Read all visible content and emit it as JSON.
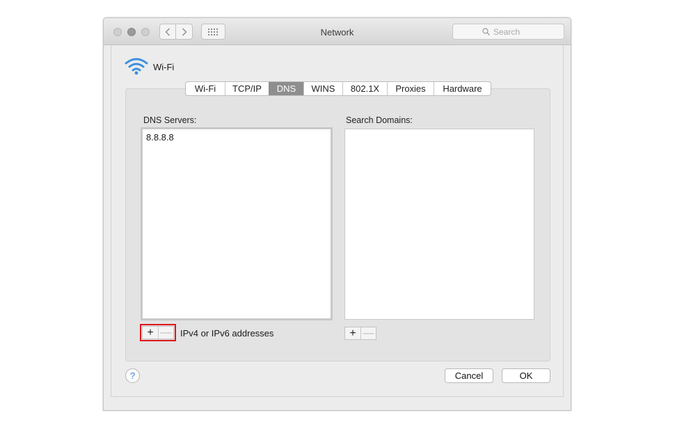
{
  "window": {
    "title": "Network",
    "search": {
      "placeholder": "Search"
    }
  },
  "interface": {
    "name": "Wi-Fi",
    "icon": "wifi-icon"
  },
  "tabs": [
    {
      "label": "Wi-Fi",
      "active": false
    },
    {
      "label": "TCP/IP",
      "active": false
    },
    {
      "label": "DNS",
      "active": true
    },
    {
      "label": "WINS",
      "active": false
    },
    {
      "label": "802.1X",
      "active": false
    },
    {
      "label": "Proxies",
      "active": false
    },
    {
      "label": "Hardware",
      "active": false
    }
  ],
  "dns": {
    "servers_label": "DNS Servers:",
    "servers": [
      "8.8.8.8"
    ],
    "hint": "IPv4 or IPv6 addresses",
    "add_symbol": "+",
    "remove_symbol": "—"
  },
  "domains": {
    "label": "Search Domains:",
    "items": [],
    "add_symbol": "+",
    "remove_symbol": "—"
  },
  "footer": {
    "help_symbol": "?",
    "cancel_label": "Cancel",
    "ok_label": "OK"
  },
  "colors": {
    "highlight": "#e0161b",
    "wifi_blue": "#3b8fe0",
    "active_tab": "#8e8e8e"
  }
}
